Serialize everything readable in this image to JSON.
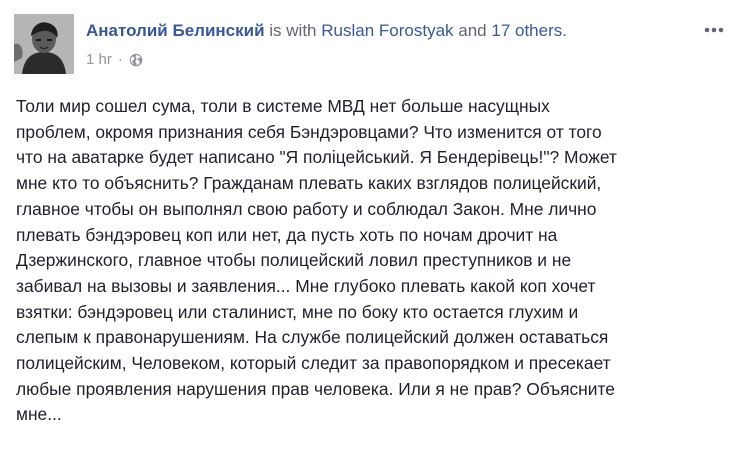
{
  "post": {
    "author": "Анатолий Белинский",
    "with_text": "is with",
    "tagged_person": "Ruslan Forostyak",
    "and_text": "and",
    "others_link": "17 others",
    "end_punct": ".",
    "timestamp": "1 hr",
    "separator": "·",
    "privacy_icon": "globe-icon",
    "more_icon": "more-options-icon",
    "body_lines": [
      "Толи мир сошел сума, толи в системе МВД нет больше насущных",
      "проблем, окромя признания себя Бэндэровцами? Что изменится от того",
      "что на аватарке будет написано \"Я поліцейський. Я Бендерівець!\"? Может",
      "мне кто то объяснить? Гражданам плевать каких взглядов полицейский,",
      "главное чтобы он выполнял свою работу и соблюдал Закон. Мне лично",
      "плевать бэндэровец коп или нет, да пусть хоть по ночам дрочит на",
      "Дзержинского, главное чтобы полицейский ловил преступников и не",
      "забивал на вызовы и заявления... Мне глубоко плевать какой коп хочет",
      "взятки: бэндэровец или сталинист, мне по боку кто остается глухим и",
      "слепым к правонарушениям. На службе полицейский должен оставаться",
      "полицейским, Человеком, который следит за правопорядком и пресекает",
      "любые проявления нарушения прав человека. Или я не прав? Объясните",
      "мне..."
    ]
  },
  "colors": {
    "link": "#385898",
    "meta": "#90949c",
    "text": "#1d2129",
    "secondary": "#606770"
  }
}
